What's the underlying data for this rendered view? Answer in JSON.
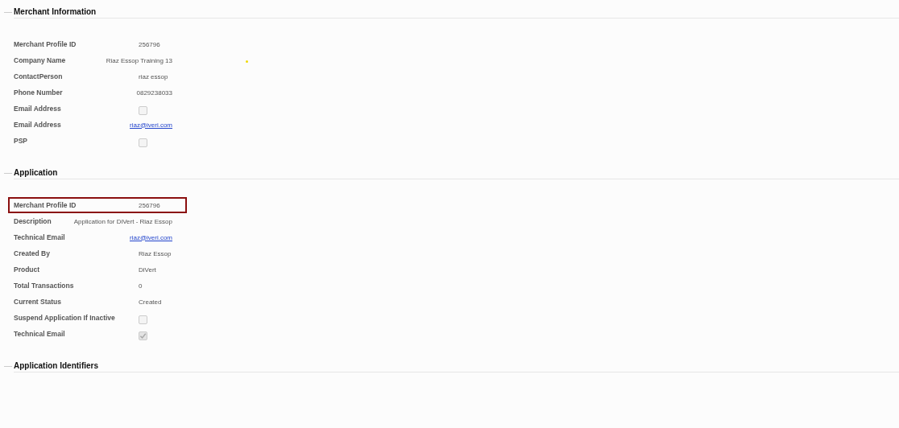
{
  "sections": [
    {
      "title": "Merchant Information",
      "rows": [
        {
          "label": "Merchant Profile ID",
          "kind": "text",
          "value": "256796",
          "highlighted": false
        },
        {
          "label": "Company Name",
          "kind": "text",
          "value": "Riaz Essop Training 13",
          "highlighted": false
        },
        {
          "label": "ContactPerson",
          "kind": "text",
          "value": "riaz essop",
          "highlighted": false
        },
        {
          "label": "Phone Number",
          "kind": "text",
          "value": "0829238033",
          "highlighted": false
        },
        {
          "label": "Email Address",
          "kind": "checkbox",
          "checked": false,
          "highlighted": false
        },
        {
          "label": "Email Address",
          "kind": "link",
          "value": "riaz@iveri.com",
          "highlighted": false
        },
        {
          "label": "PSP",
          "kind": "checkbox",
          "checked": false,
          "highlighted": false
        }
      ]
    },
    {
      "title": "Application",
      "rows": [
        {
          "label": "Merchant Profile ID",
          "kind": "text",
          "value": "256796",
          "highlighted": true
        },
        {
          "label": "Description",
          "kind": "text",
          "value": "Application for DiVert - Riaz Essop",
          "highlighted": false
        },
        {
          "label": "Technical Email",
          "kind": "link",
          "value": "riaz@iveri.com",
          "highlighted": false
        },
        {
          "label": "Created By",
          "kind": "text",
          "value": "Riaz Essop",
          "highlighted": false
        },
        {
          "label": "Product",
          "kind": "text",
          "value": "DiVert",
          "highlighted": false
        },
        {
          "label": "Total Transactions",
          "kind": "text",
          "value": "0",
          "highlighted": false
        },
        {
          "label": "Current Status",
          "kind": "text",
          "value": "Created",
          "highlighted": false
        },
        {
          "label": "Suspend Application If Inactive",
          "kind": "checkbox",
          "checked": false,
          "highlighted": false
        },
        {
          "label": "Technical Email",
          "kind": "checkbox",
          "checked": true,
          "highlighted": false
        }
      ]
    },
    {
      "title": "Application Identifiers"
    }
  ]
}
